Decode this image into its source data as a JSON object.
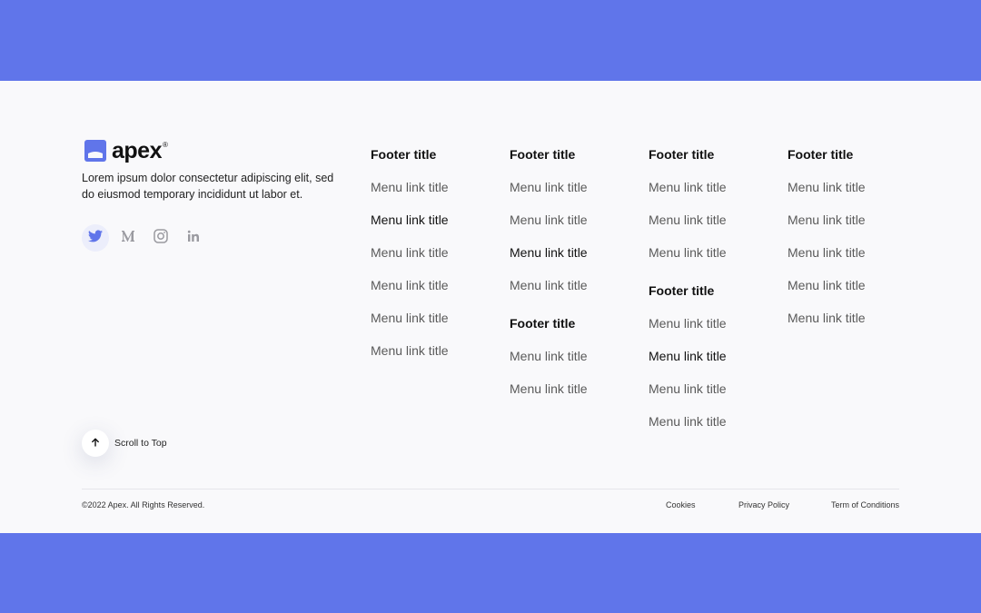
{
  "colors": {
    "background": "#6075EA",
    "footer_bg": "#F9F9FB",
    "accent": "#6075EA",
    "text_primary": "#111111",
    "text_muted": "#5A5A5A"
  },
  "brand": {
    "name": "apex",
    "trademark": "®",
    "description": "Lorem ipsum dolor consectetur adipiscing elit, sed do eiusmod temporary incididunt ut labor et."
  },
  "socials": [
    {
      "icon": "twitter-icon",
      "label": "Twitter"
    },
    {
      "icon": "medium-icon",
      "label": "Medium"
    },
    {
      "icon": "instagram-icon",
      "label": "Instagram"
    },
    {
      "icon": "linkedin-icon",
      "label": "LinkedIn"
    }
  ],
  "columns": [
    {
      "groups": [
        {
          "title": "Footer title",
          "links": [
            "Menu link title",
            "Menu link title",
            "Menu link title",
            "Menu link title",
            "Menu link title",
            "Menu link title"
          ]
        }
      ]
    },
    {
      "groups": [
        {
          "title": "Footer title",
          "links": [
            "Menu link title",
            "Menu link title",
            "Menu link title",
            "Menu link title"
          ]
        },
        {
          "title": "Footer title",
          "links": [
            "Menu link title",
            "Menu link title"
          ]
        }
      ]
    },
    {
      "groups": [
        {
          "title": "Footer title",
          "links": [
            "Menu link title",
            "Menu link title",
            "Menu link title"
          ]
        },
        {
          "title": "Footer title",
          "links": [
            "Menu link title",
            "Menu link title",
            "Menu link title",
            "Menu link title"
          ]
        }
      ]
    },
    {
      "groups": [
        {
          "title": "Footer title",
          "links": [
            "Menu link title",
            "Menu link title",
            "Menu link title",
            "Menu link title",
            "Menu link title"
          ]
        }
      ]
    }
  ],
  "scroll_top": {
    "label": "Scroll to Top",
    "icon": "arrow-up-icon"
  },
  "copyright": "©2022 Apex. All Rights Reserved.",
  "legal_links": [
    "Cookies",
    "Privacy Policy",
    "Term of Conditions"
  ]
}
